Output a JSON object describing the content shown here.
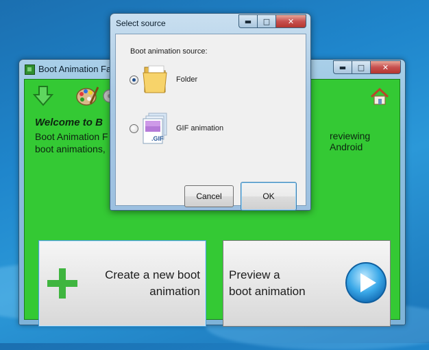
{
  "main_window": {
    "title": "Boot Animation Fac",
    "welcome": "Welcome to B",
    "description_left_1": "Boot Animation F",
    "description_right_1": "reviewing Android",
    "description_left_2": "boot animations,",
    "create_button": {
      "line1": "Create a new boot",
      "line2": "animation"
    },
    "preview_button": {
      "line1": "Preview a",
      "line2": "boot animation"
    },
    "icons": [
      "download-arrow-icon",
      "palette-icon",
      "gear-icon",
      "home-icon",
      "plus-icon",
      "play-icon"
    ]
  },
  "dialog": {
    "title": "Select source",
    "prompt": "Boot animation source:",
    "options": [
      {
        "label": "Folder",
        "icon": "folder-icon",
        "selected": true
      },
      {
        "label": "GIF animation",
        "icon": "gif-file-icon",
        "selected": false
      },
      {
        "icon_text": ".GIF"
      }
    ],
    "cancel_label": "Cancel",
    "ok_label": "OK"
  },
  "colors": {
    "client_green": "#34c934",
    "dialog_bg": "#f0f0f0",
    "desktop_blue": "#1f86cc"
  }
}
